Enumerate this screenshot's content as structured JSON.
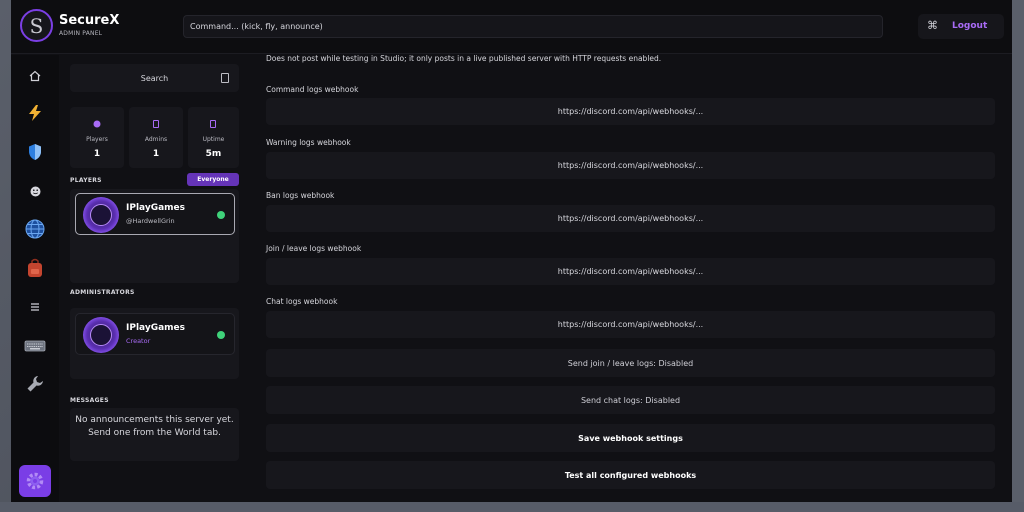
{
  "header": {
    "brand_title": "SecureX",
    "brand_subtitle": "ADMIN PANEL",
    "command_placeholder": "Command... (kick, fly, announce)",
    "logout_label": "Logout"
  },
  "rail": {
    "icons": [
      "home-icon",
      "lightning-icon",
      "shield-icon",
      "smiley-icon",
      "globe-icon",
      "backpack-icon",
      "list-icon",
      "keyboard-icon",
      "wrench-icon",
      "gear-icon"
    ]
  },
  "left": {
    "search_placeholder": "Search",
    "stats": [
      {
        "label": "Players",
        "value": "1"
      },
      {
        "label": "Admins",
        "value": "1"
      },
      {
        "label": "Uptime",
        "value": "5m"
      }
    ],
    "players_label": "PLAYERS",
    "everyone_badge": "Everyone",
    "players": [
      {
        "name": "IPlayGames",
        "handle": "@HardwellGrin"
      }
    ],
    "administrators_label": "ADMINISTRATORS",
    "administrators": [
      {
        "name": "IPlayGames",
        "role": "Creator"
      }
    ],
    "messages_label": "MESSAGES",
    "messages_empty": "No announcements this server yet. Send one from the World tab."
  },
  "content": {
    "description": "Does not post while testing in Studio; it only posts in a live published server with HTTP requests enabled.",
    "fields": [
      {
        "label": "Command logs webhook",
        "placeholder": "https://discord.com/api/webhooks/..."
      },
      {
        "label": "Warning logs webhook",
        "placeholder": "https://discord.com/api/webhooks/..."
      },
      {
        "label": "Ban logs webhook",
        "placeholder": "https://discord.com/api/webhooks/..."
      },
      {
        "label": "Join / leave logs webhook",
        "placeholder": "https://discord.com/api/webhooks/..."
      },
      {
        "label": "Chat logs webhook",
        "placeholder": "https://discord.com/api/webhooks/..."
      }
    ],
    "buttons": {
      "join_leave_toggle": "Send join / leave logs: Disabled",
      "chat_toggle": "Send chat logs: Disabled",
      "save": "Save webhook settings",
      "test": "Test all configured webhooks"
    }
  },
  "colors": {
    "accent": "#7a3ee6",
    "logout": "#a86bf5",
    "online": "#3fd27a",
    "creator": "#a86bf5"
  }
}
